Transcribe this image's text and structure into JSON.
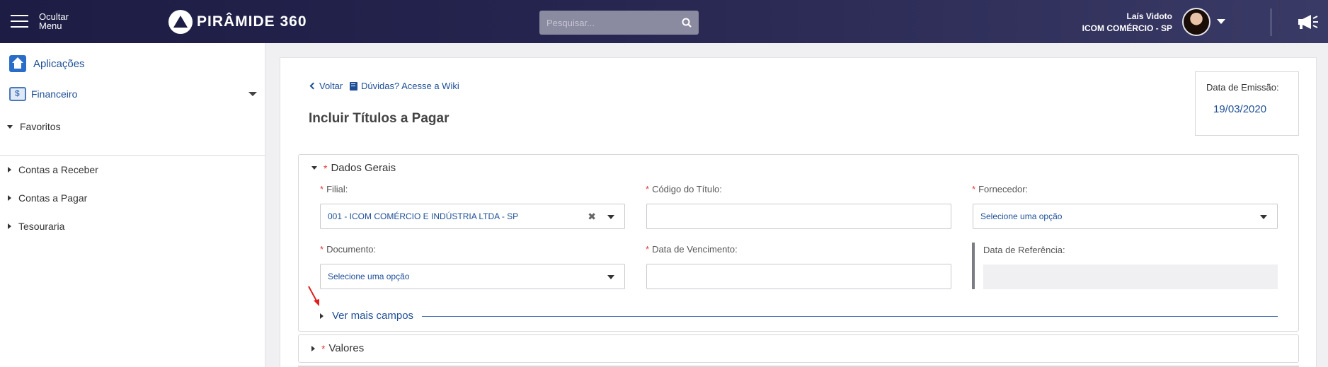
{
  "header": {
    "menu_toggle_line1": "Ocultar",
    "menu_toggle_line2": "Menu",
    "brand": "PIRÂMIDE 360",
    "search_placeholder": "Pesquisar...",
    "user_name": "Laís Vidoto",
    "user_company": "ICOM COMÉRCIO - SP"
  },
  "sidebar": {
    "apps_label": "Aplicações",
    "module_label": "Financeiro",
    "favorites_label": "Favoritos",
    "items": [
      {
        "label": "Contas a Receber"
      },
      {
        "label": "Contas a Pagar"
      },
      {
        "label": "Tesouraria"
      }
    ]
  },
  "main": {
    "back_label": "Voltar",
    "wiki_label": "Dúvidas? Acesse a Wiki",
    "page_title": "Incluir Títulos a Pagar",
    "emission_label": "Data de Emissão:",
    "emission_value": "19/03/2020",
    "general_section": "Dados Gerais",
    "values_section": "Valores",
    "more_fields_label": "Ver mais campos",
    "fields": {
      "filial": {
        "label": "Filial:",
        "value": "001 - ICOM COMÉRCIO E INDÚSTRIA LTDA - SP"
      },
      "codigo": {
        "label": "Código do Título:",
        "value": ""
      },
      "fornecedor": {
        "label": "Fornecedor:",
        "value": "Selecione uma opção"
      },
      "documento": {
        "label": "Documento:",
        "value": "Selecione uma opção"
      },
      "vencimento": {
        "label": "Data de Vencimento:",
        "value": ""
      },
      "referencia": {
        "label": "Data de Referência:",
        "value": ""
      }
    }
  },
  "colors": {
    "header_bg": "#1c1c44",
    "link": "#1e4f96",
    "required": "#e03a3a",
    "annotation_arrow": "#e02020"
  },
  "icons": [
    "menu-icon",
    "logo-icon",
    "search-icon",
    "chevron-down-icon",
    "megaphone-icon",
    "home-icon",
    "finance-icon",
    "chevron-left-icon",
    "book-icon",
    "clear-icon"
  ]
}
